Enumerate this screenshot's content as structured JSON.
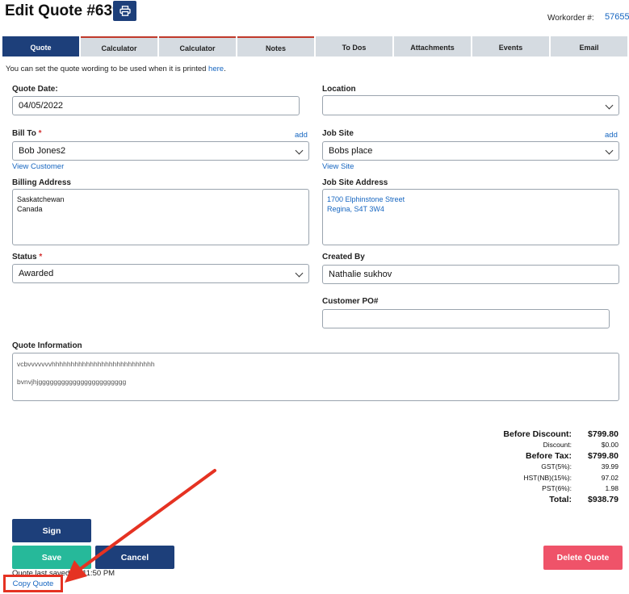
{
  "header": {
    "title": "Edit Quote #639",
    "workorder_label": "Workorder #:",
    "workorder_value": "57655"
  },
  "tabs": [
    {
      "label": "Quote",
      "active": true
    },
    {
      "label": "Calculator",
      "active": false
    },
    {
      "label": "Calculator",
      "active": false
    },
    {
      "label": "Notes",
      "active": false
    },
    {
      "label": "To Dos",
      "active": false
    },
    {
      "label": "Attachments",
      "active": false
    },
    {
      "label": "Events",
      "active": false
    },
    {
      "label": "Email",
      "active": false
    }
  ],
  "hint": {
    "text": "You can set the quote wording to be used when it is printed ",
    "link": "here",
    "end": "."
  },
  "form": {
    "quote_date_label": "Quote Date:",
    "quote_date_value": "04/05/2022",
    "location_label": "Location",
    "location_value": "",
    "bill_to_label": "Bill To",
    "bill_to_value": "Bob Jones2",
    "add_label": "add",
    "view_customer": "View Customer",
    "job_site_label": "Job Site",
    "job_site_value": "Bobs place",
    "view_site": "View Site",
    "billing_address_label": "Billing Address",
    "billing_address_lines": [
      "Saskatchewan",
      "Canada"
    ],
    "job_site_address_label": "Job Site Address",
    "job_site_address_lines": [
      "1700 Elphinstone Street",
      "Regina, S4T 3W4"
    ],
    "status_label": "Status",
    "status_value": "Awarded",
    "created_by_label": "Created By",
    "created_by_value": "Nathalie sukhov",
    "customer_po_label": "Customer PO#",
    "customer_po_value": "",
    "quote_info_label": "Quote Information",
    "quote_info_lines": [
      "vcbvvvvvvvhhhhhhhhhhhhhhhhhhhhhhhhhhh",
      "bvnvjhjggggggggggggggggggggggg"
    ]
  },
  "totals": [
    {
      "label": "Before Discount:",
      "value": "$799.80",
      "big": true
    },
    {
      "label": "Discount:",
      "value": "$0.00",
      "big": false
    },
    {
      "label": "Before Tax:",
      "value": "$799.80",
      "big": true
    },
    {
      "label": "GST(5%):",
      "value": "39.99",
      "big": false
    },
    {
      "label": "HST(NB)(15%):",
      "value": "97.02",
      "big": false
    },
    {
      "label": "PST(6%):",
      "value": "1.98",
      "big": false
    },
    {
      "label": "Total:",
      "value": "$938.79",
      "big": true
    }
  ],
  "buttons": {
    "sign": "Sign",
    "save": "Save",
    "cancel": "Cancel",
    "delete": "Delete Quote",
    "copy": "Copy Quote"
  },
  "status_bar": {
    "saved_text": "Quote last saved 02:11:50 PM"
  },
  "colors": {
    "navy": "#1d3f7a",
    "green": "#26b99a",
    "danger": "#ef5369",
    "link": "#1565c0",
    "annotation": "#e53222"
  },
  "icons": {
    "print": "printer-icon",
    "select": "chevron-down-icon"
  }
}
